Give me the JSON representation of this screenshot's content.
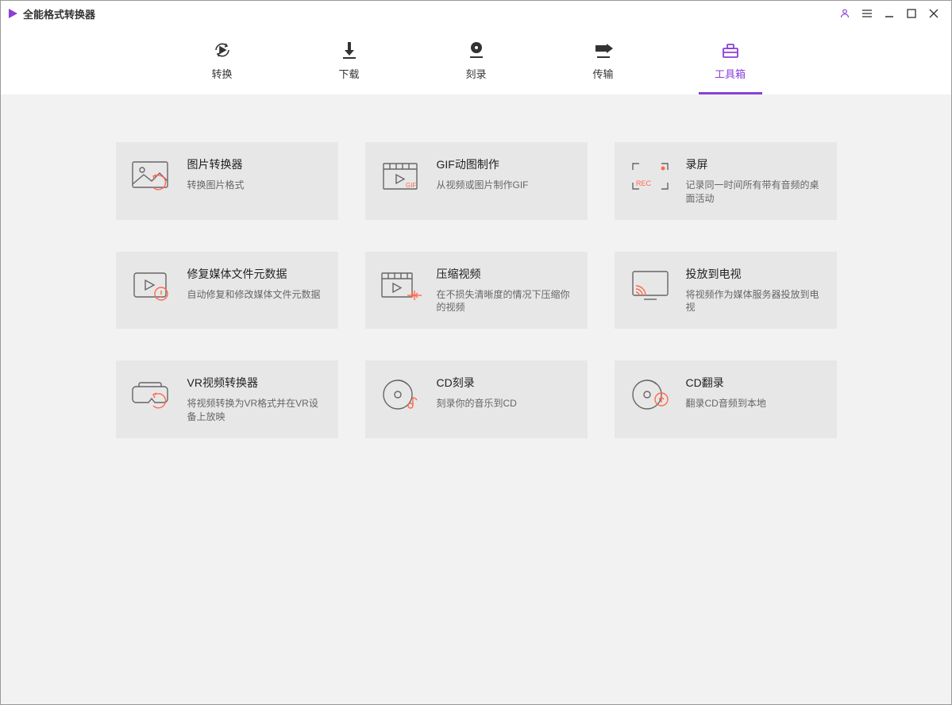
{
  "app": {
    "title": "全能格式转换器"
  },
  "nav": {
    "items": [
      {
        "label": "转换"
      },
      {
        "label": "下载"
      },
      {
        "label": "刻录"
      },
      {
        "label": "传输"
      },
      {
        "label": "工具箱"
      }
    ]
  },
  "tools": [
    {
      "title": "图片转换器",
      "desc": "转换图片格式"
    },
    {
      "title": "GIF动图制作",
      "desc": "从视频或图片制作GIF"
    },
    {
      "title": "录屏",
      "desc": "记录同一时间所有带有音频的桌面活动"
    },
    {
      "title": "修复媒体文件元数据",
      "desc": "自动修复和修改媒体文件元数据"
    },
    {
      "title": "压缩视频",
      "desc": "在不损失清晰度的情况下压缩你的视频"
    },
    {
      "title": "投放到电视",
      "desc": "将视频作为媒体服务器投放到电视"
    },
    {
      "title": "VR视频转换器",
      "desc": "将视频转换为VR格式并在VR设备上放映"
    },
    {
      "title": "CD刻录",
      "desc": "刻录你的音乐到CD"
    },
    {
      "title": "CD翻录",
      "desc": "翻录CD音频到本地"
    }
  ]
}
